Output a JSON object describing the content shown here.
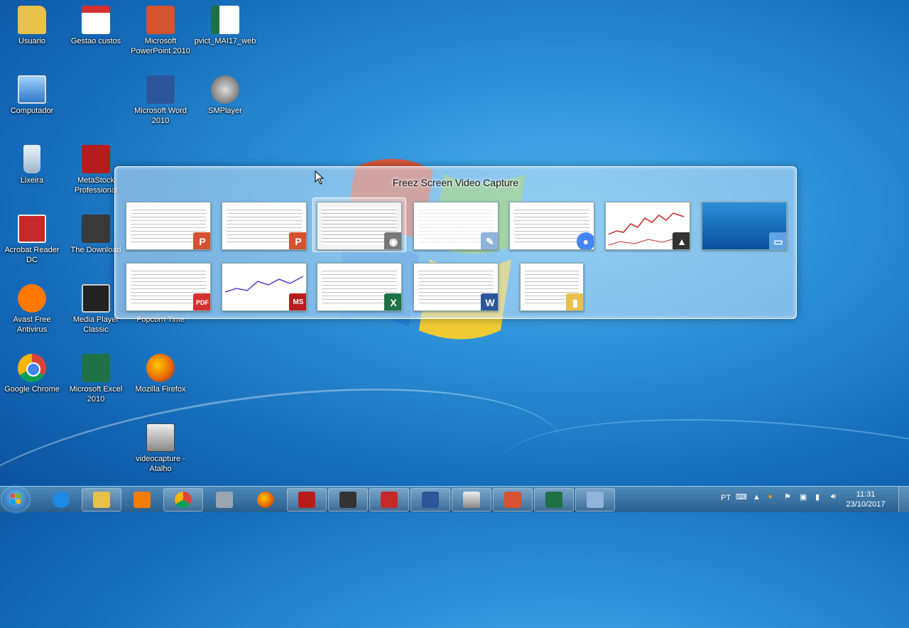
{
  "desktop": {
    "icons": [
      {
        "label": "Usuario",
        "icon": "user-folder-icon",
        "color": "#e8c04a"
      },
      {
        "label": "Gestao custos",
        "icon": "pdf-file-icon",
        "color": "#d32f2f"
      },
      {
        "label": "Microsoft PowerPoint 2010",
        "icon": "powerpoint-icon",
        "color": "#d35230"
      },
      {
        "label": "pvict_MAI17_web",
        "icon": "excel-file-icon",
        "color": "#1e7145"
      },
      {
        "label": "Computador",
        "icon": "computer-icon",
        "color": "#4a90d9"
      },
      {
        "label": "Microsoft Word 2010",
        "icon": "word-icon",
        "color": "#2b579a"
      },
      {
        "label": "SMPlayer",
        "icon": "smplayer-icon",
        "color": "#555555"
      },
      {
        "label": "Lixeira",
        "icon": "recycle-bin-icon",
        "color": "#c8d8e8"
      },
      {
        "label": "MetaStock Professional",
        "icon": "metastock-icon",
        "color": "#b71c1c"
      },
      {
        "label": "Acrobat Reader DC",
        "icon": "acrobat-icon",
        "color": "#c62828"
      },
      {
        "label": "The Download",
        "icon": "downloader-icon",
        "color": "#3a3a3a"
      },
      {
        "label": "Avast Free Antivirus",
        "icon": "avast-icon",
        "color": "#ff7800"
      },
      {
        "label": "Media Player Classic",
        "icon": "media-player-classic-icon",
        "color": "#222222"
      },
      {
        "label": "Popcorn Time",
        "icon": "popcorn-icon",
        "color": "#c62828"
      },
      {
        "label": "Google Chrome",
        "icon": "chrome-icon",
        "color": "#4285f4"
      },
      {
        "label": "Microsoft Excel 2010",
        "icon": "excel-icon",
        "color": "#1e7145"
      },
      {
        "label": "Mozilla Firefox",
        "icon": "firefox-icon",
        "color": "#e66000"
      },
      {
        "label": "videocapture - Atalho",
        "icon": "camera-icon",
        "color": "#888888"
      }
    ]
  },
  "alttab": {
    "title": "Freez Screen Video Capture",
    "windows": [
      {
        "icon": "powerpoint-icon",
        "badge": "P",
        "color": "#d35230"
      },
      {
        "icon": "powerpoint-icon",
        "badge": "P",
        "color": "#d35230"
      },
      {
        "icon": "camera-icon",
        "badge": "◉",
        "color": "#777777"
      },
      {
        "icon": "paint-icon",
        "badge": "✎",
        "color": "#8fb3d9"
      },
      {
        "icon": "chrome-icon",
        "badge": "●",
        "color": "#4285f4"
      },
      {
        "icon": "chart-app-icon",
        "badge": "▲",
        "color": "#333333"
      },
      {
        "icon": "desktop-icon",
        "badge": "▭",
        "color": "#5fa3e0"
      },
      {
        "icon": "pdf-icon",
        "badge": "PDF",
        "color": "#d32f2f"
      },
      {
        "icon": "metastock-icon",
        "badge": "MS",
        "color": "#b71c1c"
      },
      {
        "icon": "excel-icon",
        "badge": "X",
        "color": "#1e7145"
      },
      {
        "icon": "word-icon",
        "badge": "W",
        "color": "#2b579a"
      },
      {
        "icon": "folder-icon",
        "badge": "▮",
        "color": "#e8c04a"
      }
    ]
  },
  "taskbar": {
    "items": [
      {
        "icon": "internet-explorer-icon",
        "color": "#1e88e5"
      },
      {
        "icon": "file-explorer-icon",
        "color": "#e8c04a"
      },
      {
        "icon": "media-player-icon",
        "color": "#f57c00"
      },
      {
        "icon": "chrome-icon",
        "color": "#4285f4"
      },
      {
        "icon": "calculator-icon",
        "color": "#9aa5b1"
      },
      {
        "icon": "firefox-icon",
        "color": "#e66000"
      },
      {
        "icon": "metastock-icon",
        "color": "#b71c1c"
      },
      {
        "icon": "chart-app-icon",
        "color": "#333333"
      },
      {
        "icon": "acrobat-icon",
        "color": "#c62828"
      },
      {
        "icon": "word-icon",
        "color": "#2b579a"
      },
      {
        "icon": "camera-icon",
        "color": "#888888"
      },
      {
        "icon": "powerpoint-icon",
        "color": "#d35230"
      },
      {
        "icon": "excel-icon",
        "color": "#1e7145"
      },
      {
        "icon": "paint-icon",
        "color": "#8fb3d9"
      }
    ],
    "tray": {
      "language": "PT",
      "time": "11:31",
      "date": "23/10/2017"
    }
  }
}
